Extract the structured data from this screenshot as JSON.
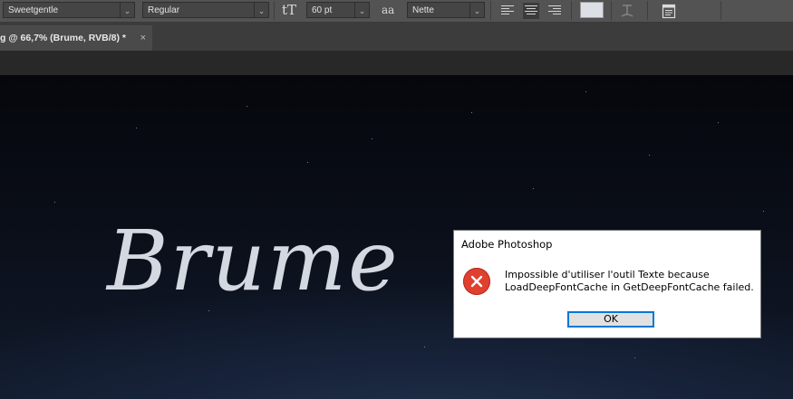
{
  "options_bar": {
    "font_family": "Sweetgentle",
    "font_style": "Regular",
    "text_size_icon": "tT",
    "font_size": "60 pt",
    "antialias_icon": "aa",
    "antialias": "Nette",
    "text_color": "#dcdfe6"
  },
  "tab": {
    "title": "g @ 66,7% (Brume, RVB/8) *",
    "close": "×"
  },
  "canvas": {
    "text": "Brume"
  },
  "dialog": {
    "title": "Adobe Photoshop",
    "message_line1": "Impossible d'utiliser l'outil Texte because",
    "message_line2": "LoadDeepFontCache in GetDeepFontCache failed.",
    "ok_label": "OK"
  }
}
